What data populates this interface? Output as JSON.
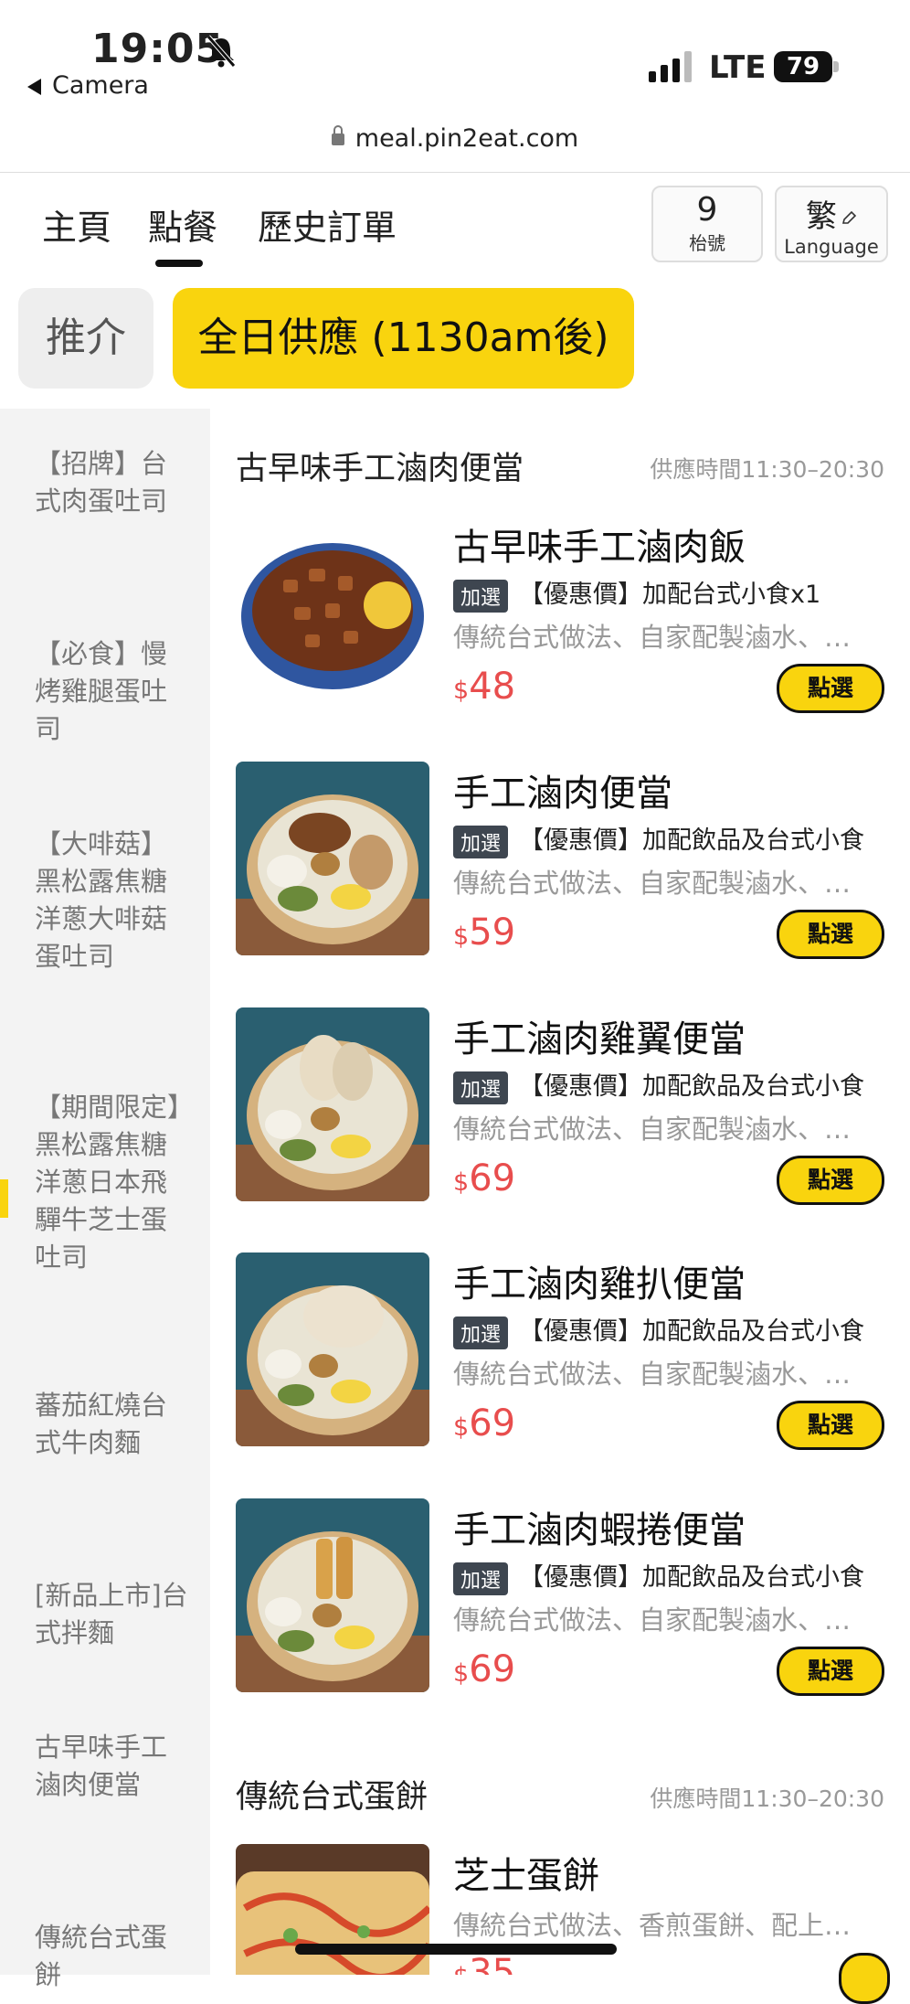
{
  "status_bar": {
    "time": "19:05",
    "back_label": "Camera",
    "network": "LTE",
    "battery": "79"
  },
  "browser": {
    "url": "meal.pin2eat.com"
  },
  "nav": {
    "tabs": [
      "主頁",
      "點餐",
      "歷史訂單"
    ],
    "active_tab": "點餐",
    "table_number": "9",
    "table_label": "枱號",
    "language_char": "繁",
    "language_label": "Language"
  },
  "categories": {
    "pills": [
      "推介",
      "全日供應 (1130am後)"
    ],
    "selected": "全日供應 (1130am後)"
  },
  "sidebar": {
    "items": [
      "【招牌】台式肉蛋吐司",
      "【必食】慢烤雞腿蛋吐司",
      "【大啡菇】黑松露焦糖洋蔥大啡菇蛋吐司",
      "【期間限定】黑松露焦糖洋蔥日本飛驒牛芝士蛋吐司",
      "蕃茄紅燒台式牛肉麵",
      "[新品上市]台式拌麵",
      "古早味手工滷肉便當",
      "傳統台式蛋餅"
    ]
  },
  "sections": [
    {
      "title": "古早味手工滷肉便當",
      "time": "供應時間11:30–20:30",
      "items": [
        {
          "name": "古早味手工滷肉飯",
          "tag": "加選",
          "promo": "【優惠價】加配台式小食x1",
          "desc": "傳統台式做法、自家配製滷水、慢火燉煮",
          "currency": "$",
          "price": "48",
          "button": "點選"
        },
        {
          "name": "手工滷肉便當",
          "tag": "加選",
          "promo": "【優惠價】加配飲品及台式小食",
          "desc": "傳統台式做法、自家配製滷水、慢火燉煮",
          "currency": "$",
          "price": "59",
          "button": "點選"
        },
        {
          "name": "手工滷肉雞翼便當",
          "tag": "加選",
          "promo": "【優惠價】加配飲品及台式小食",
          "desc": "傳統台式做法、自家配製滷水、慢火燉煮",
          "currency": "$",
          "price": "69",
          "button": "點選"
        },
        {
          "name": "手工滷肉雞扒便當",
          "tag": "加選",
          "promo": "【優惠價】加配飲品及台式小食",
          "desc": "傳統台式做法、自家配製滷水、慢火燉煮",
          "currency": "$",
          "price": "69",
          "button": "點選"
        },
        {
          "name": "手工滷肉蝦捲便當",
          "tag": "加選",
          "promo": "【優惠價】加配飲品及台式小食",
          "desc": "傳統台式做法、自家配製滷水、慢火燉煮",
          "currency": "$",
          "price": "69",
          "button": "點選"
        }
      ]
    },
    {
      "title": "傳統台式蛋餅",
      "time": "供應時間11:30–20:30",
      "items": [
        {
          "name": "芝士蛋餅",
          "desc": "傳統台式做法、香煎蛋餅、配上芝士",
          "currency": "$",
          "price": "35"
        }
      ]
    }
  ],
  "colors": {
    "accent": "#f9d40e",
    "price": "#e84d4d",
    "tag": "#3e4650"
  },
  "icons": [
    "mute-bell-icon",
    "signal-icon",
    "battery-icon",
    "lock-icon",
    "pencil-icon"
  ]
}
